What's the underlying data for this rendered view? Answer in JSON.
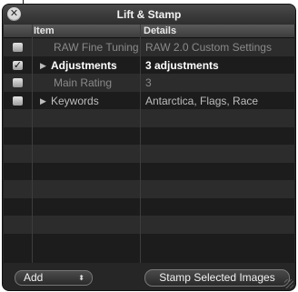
{
  "window": {
    "title": "Lift & Stamp",
    "close_glyph": "✕",
    "close_icon": "close-icon"
  },
  "columns": {
    "item": "Item",
    "details": "Details"
  },
  "rows": [
    {
      "checked": false,
      "expandable": false,
      "item": "RAW Fine Tuning",
      "details": "RAW 2.0 Custom Settings",
      "style": "dim"
    },
    {
      "checked": true,
      "expandable": true,
      "item": "Adjustments",
      "details": "3 adjustments",
      "style": "bright"
    },
    {
      "checked": false,
      "expandable": false,
      "item": "Main Rating",
      "details": "3",
      "style": "dim"
    },
    {
      "checked": false,
      "expandable": true,
      "item": "Keywords",
      "details": "Antarctica, Flags, Race",
      "style": "mid"
    }
  ],
  "empty_row_count": 8,
  "footer": {
    "popup_value": "Add",
    "popup_arrows": "⬍",
    "stamp_label": "Stamp Selected Images"
  },
  "glyphs": {
    "check": "✓",
    "disclosure": "▶"
  }
}
